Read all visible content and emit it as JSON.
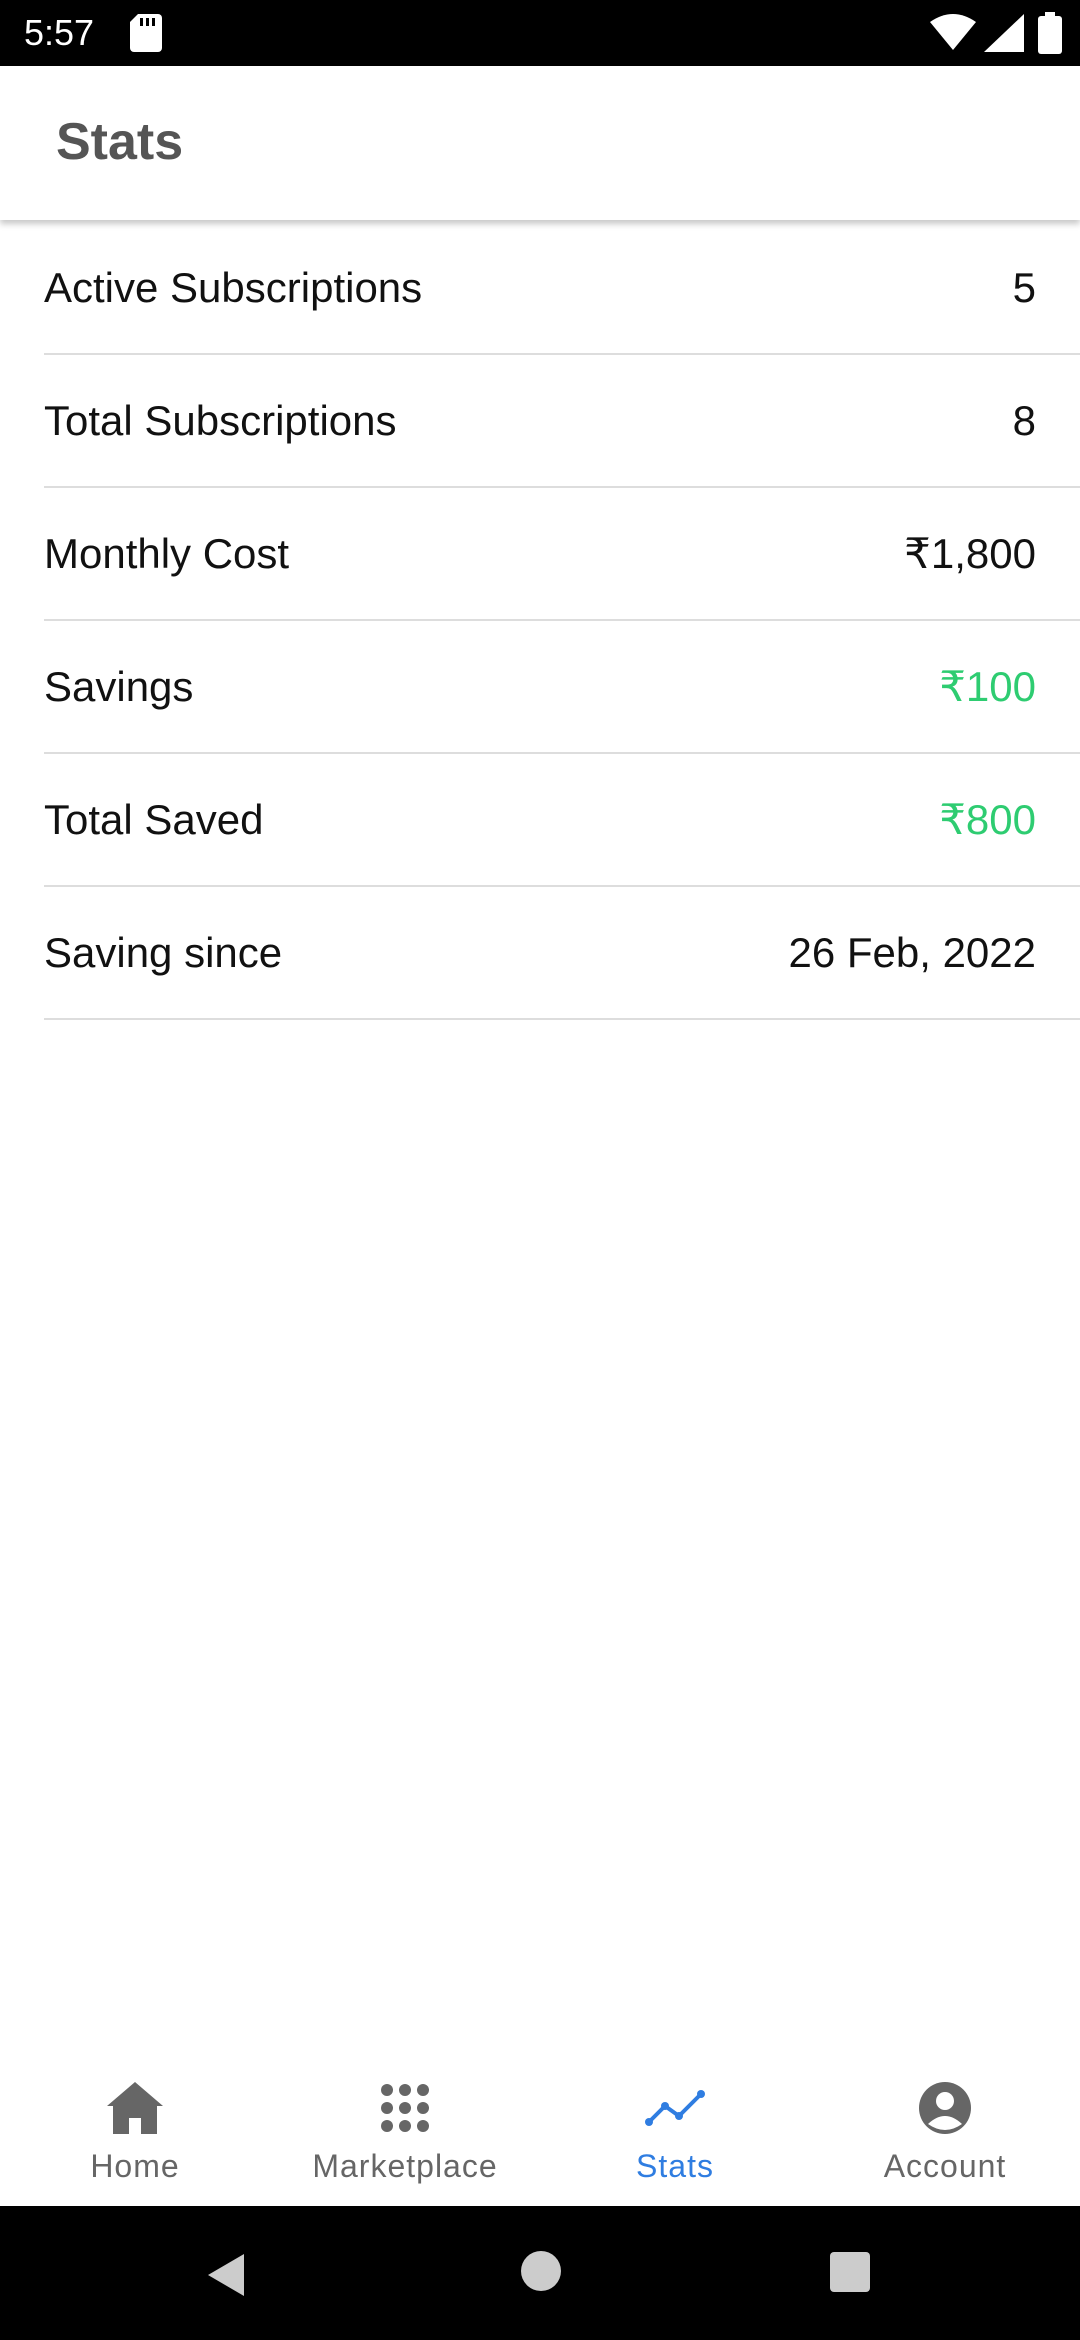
{
  "status_bar": {
    "time": "5:57"
  },
  "app_bar": {
    "title": "Stats"
  },
  "stats": [
    {
      "label": "Active Subscriptions",
      "value": "5",
      "highlight": false
    },
    {
      "label": "Total Subscriptions",
      "value": "8",
      "highlight": false
    },
    {
      "label": "Monthly Cost",
      "value": "₹1,800",
      "highlight": false
    },
    {
      "label": "Savings",
      "value": "₹100",
      "highlight": true
    },
    {
      "label": "Total Saved",
      "value": "₹800",
      "highlight": true
    },
    {
      "label": "Saving since",
      "value": "26 Feb, 2022",
      "highlight": false
    }
  ],
  "bottom_nav": {
    "items": [
      {
        "label": "Home",
        "icon": "home-icon",
        "active": false
      },
      {
        "label": "Marketplace",
        "icon": "apps-grid-icon",
        "active": false
      },
      {
        "label": "Stats",
        "icon": "trend-line-icon",
        "active": true
      },
      {
        "label": "Account",
        "icon": "account-circle-icon",
        "active": false
      }
    ]
  },
  "colors": {
    "accent": "#2f7de1",
    "positive": "#2ecc71",
    "nav_inactive": "#666666"
  }
}
